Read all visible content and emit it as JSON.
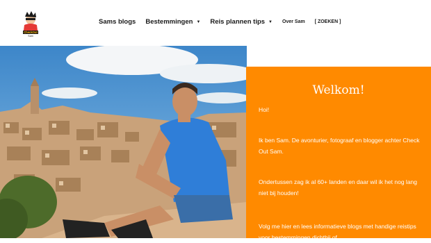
{
  "header": {
    "logo_text": "CheckOutSam",
    "nav": [
      {
        "label": "Sams blogs",
        "has_dropdown": false
      },
      {
        "label": "Bestemmingen",
        "has_dropdown": true
      },
      {
        "label": "Reis plannen tips",
        "has_dropdown": true
      },
      {
        "label": "Over Sam",
        "has_dropdown": false
      },
      {
        "label": "[ ZOEKEN ]",
        "has_dropdown": false
      }
    ]
  },
  "panel": {
    "title": "Welkom!",
    "greeting": "Hoi!",
    "intro": "Ik ben Sam. De avonturier, fotograaf en blogger achter Check Out Sam.",
    "countries": "Ondertussen zag ik al 60+ landen en daar wil ik het nog lang niet bij houden!",
    "follow": "Volg me hier en lees informatieve blogs met handige reistips voor bestemmingen dichtbij of"
  },
  "colors": {
    "accent": "#ff8a00",
    "text": "#1a1a1a"
  }
}
